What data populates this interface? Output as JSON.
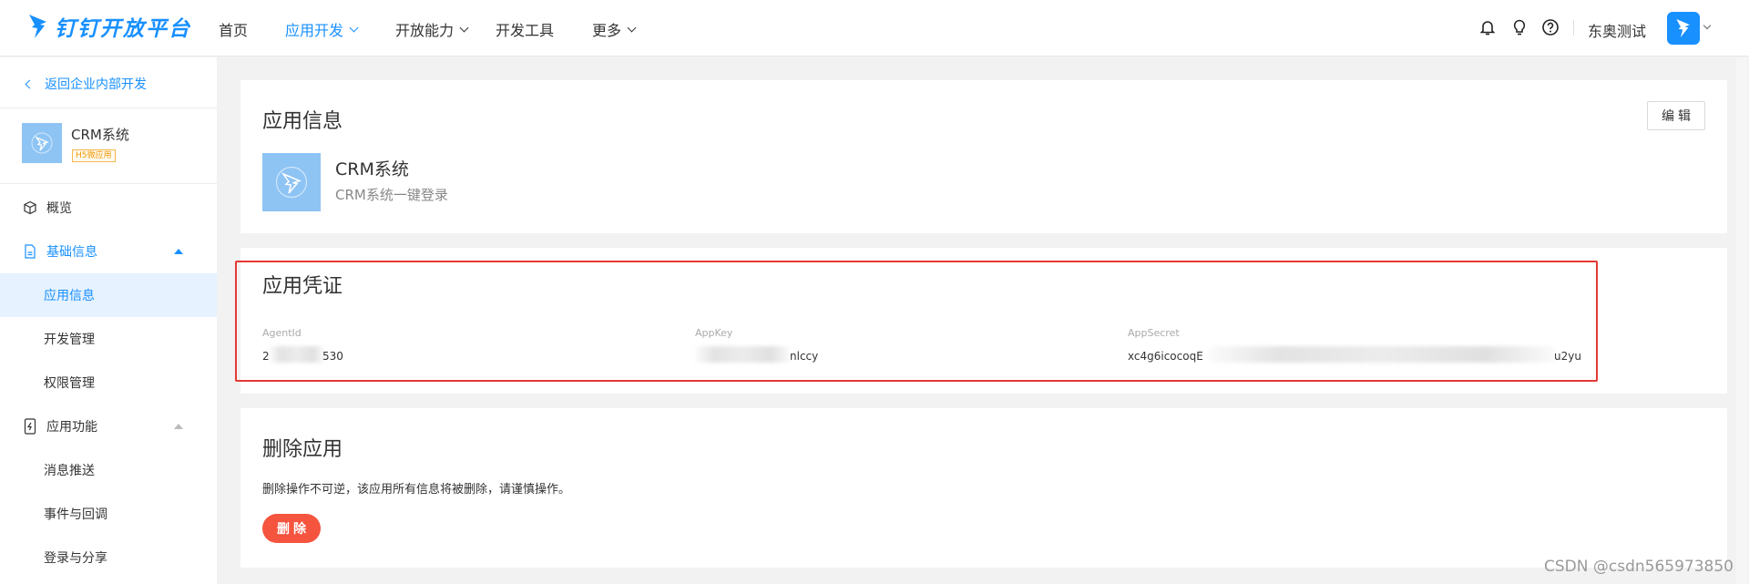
{
  "header": {
    "logo_text": "钉钉开放平台",
    "nav": [
      {
        "label": "首页"
      },
      {
        "label": "应用开发"
      },
      {
        "label": "开放能力"
      },
      {
        "label": "开发工具"
      },
      {
        "label": "更多"
      }
    ],
    "user_name": "东奥测试"
  },
  "sidebar": {
    "back_label": "返回企业内部开发",
    "app": {
      "name": "CRM系统",
      "badge": "H5微应用"
    },
    "menu": [
      {
        "label": "概览"
      },
      {
        "label": "基础信息"
      },
      {
        "label": "应用信息"
      },
      {
        "label": "开发管理"
      },
      {
        "label": "权限管理"
      },
      {
        "label": "应用功能"
      },
      {
        "label": "消息推送"
      },
      {
        "label": "事件与回调"
      },
      {
        "label": "登录与分享"
      }
    ]
  },
  "app_info": {
    "title": "应用信息",
    "edit_label": "编辑",
    "app_name": "CRM系统",
    "app_desc": "CRM系统一键登录"
  },
  "credentials": {
    "title": "应用凭证",
    "agent_id": {
      "label": "AgentId",
      "value_start": "2",
      "value_end": "530"
    },
    "app_key": {
      "label": "AppKey",
      "value_start": "",
      "value_end": "nlccy"
    },
    "app_secret": {
      "label": "AppSecret",
      "value_start": "xc4g6icocoqE",
      "value_end": "u2yu"
    }
  },
  "delete_app": {
    "title": "删除应用",
    "description": "删除操作不可逆，该应用所有信息将被删除，请谨慎操作。",
    "button_label": "删除"
  },
  "watermark": "CSDN @csdn565973850",
  "colors": {
    "accent": "#1890ff",
    "danger": "#f5543e",
    "highlight": "#e53935"
  }
}
